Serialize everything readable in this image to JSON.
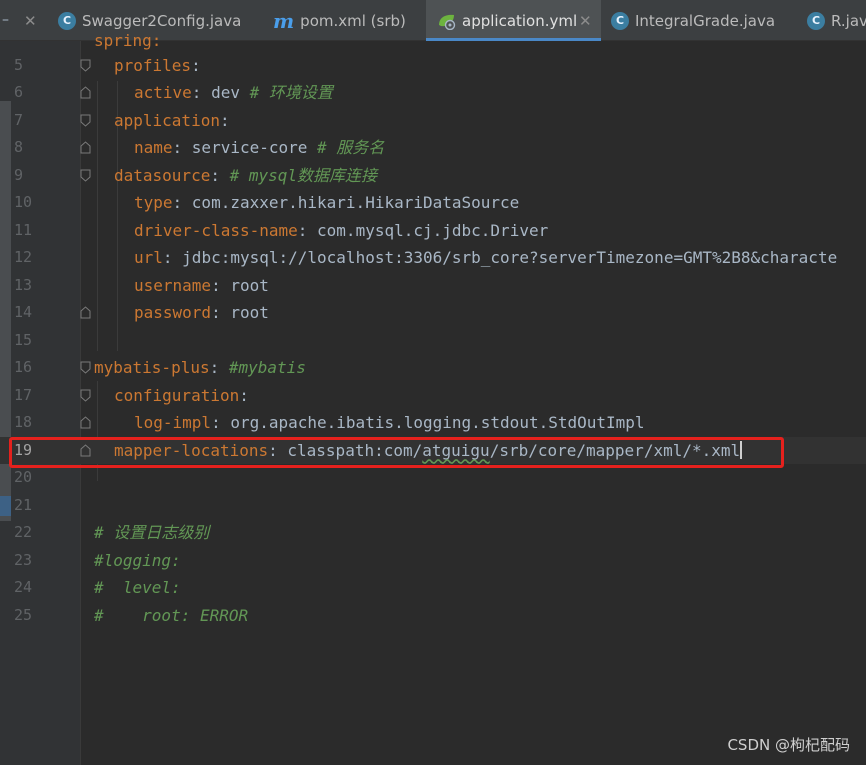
{
  "tabs": [
    {
      "label": "Swagger2Config.java",
      "icon": "java-class-icon",
      "active": false
    },
    {
      "label": "pom.xml (srb)",
      "icon": "maven-icon",
      "active": false
    },
    {
      "label": "application.yml",
      "icon": "spring-config-icon",
      "active": true
    },
    {
      "label": "IntegralGrade.java",
      "icon": "java-class-icon",
      "active": false
    },
    {
      "label": "R.java",
      "icon": "java-class-icon",
      "active": false
    }
  ],
  "top_partial": "spring:",
  "lines": [
    {
      "n": "5",
      "key": "profiles",
      "sep": ":",
      "val": "",
      "comment": ""
    },
    {
      "n": "6",
      "key": "active",
      "sep": ": ",
      "val": "dev",
      "comment": "# 环境设置"
    },
    {
      "n": "7",
      "key": "application",
      "sep": ":",
      "val": "",
      "comment": ""
    },
    {
      "n": "8",
      "key": "name",
      "sep": ": ",
      "val": "service-core",
      "comment": "# 服务名"
    },
    {
      "n": "9",
      "key": "datasource",
      "sep": ": ",
      "val": "",
      "comment": "# mysql数据库连接"
    },
    {
      "n": "10",
      "key": "type",
      "sep": ": ",
      "val": "com.zaxxer.hikari.HikariDataSource",
      "comment": ""
    },
    {
      "n": "11",
      "key": "driver-class-name",
      "sep": ": ",
      "val": "com.mysql.cj.jdbc.Driver",
      "comment": ""
    },
    {
      "n": "12",
      "key": "url",
      "sep": ": ",
      "val": "jdbc:mysql://localhost:3306/srb_core?serverTimezone=GMT%2B8&characte",
      "comment": ""
    },
    {
      "n": "13",
      "key": "username",
      "sep": ": ",
      "val": "root",
      "comment": ""
    },
    {
      "n": "14",
      "key": "password",
      "sep": ": ",
      "val": "root",
      "comment": ""
    },
    {
      "n": "15",
      "key": "",
      "sep": "",
      "val": "",
      "comment": ""
    },
    {
      "n": "16",
      "key": "mybatis-plus",
      "sep": ": ",
      "val": "",
      "comment": "#mybatis"
    },
    {
      "n": "17",
      "key": "configuration",
      "sep": ":",
      "val": "",
      "comment": ""
    },
    {
      "n": "18",
      "key": "log-impl",
      "sep": ": ",
      "val": "org.apache.ibatis.logging.stdout.StdOutImpl",
      "comment": ""
    },
    {
      "n": "19",
      "key": "mapper-locations",
      "sep": ": ",
      "val": "",
      "comment": ""
    },
    {
      "n": "20",
      "key": "",
      "sep": "",
      "val": "",
      "comment": ""
    },
    {
      "n": "21",
      "key": "",
      "sep": "",
      "val": "",
      "comment": ""
    },
    {
      "n": "22",
      "key": "",
      "sep": "",
      "val": "",
      "comment": "# 设置日志级别"
    },
    {
      "n": "23",
      "key": "",
      "sep": "",
      "val": "",
      "comment": "#logging:"
    },
    {
      "n": "24",
      "key": "",
      "sep": "",
      "val": "",
      "comment": "#  level:"
    },
    {
      "n": "25",
      "key": "",
      "sep": "",
      "val": "",
      "comment": "#    root: ERROR"
    }
  ],
  "line19": {
    "pre": "classpath:com/",
    "squiggle": "atguigu",
    "post": "/srb/core/mapper/xml/*.xml"
  },
  "watermark": "CSDN @枸杞配码",
  "colors": {
    "key": "#cc7832",
    "comment": "#629755",
    "highlight": "#e5211d",
    "tab_underline": "#4a88c7"
  }
}
